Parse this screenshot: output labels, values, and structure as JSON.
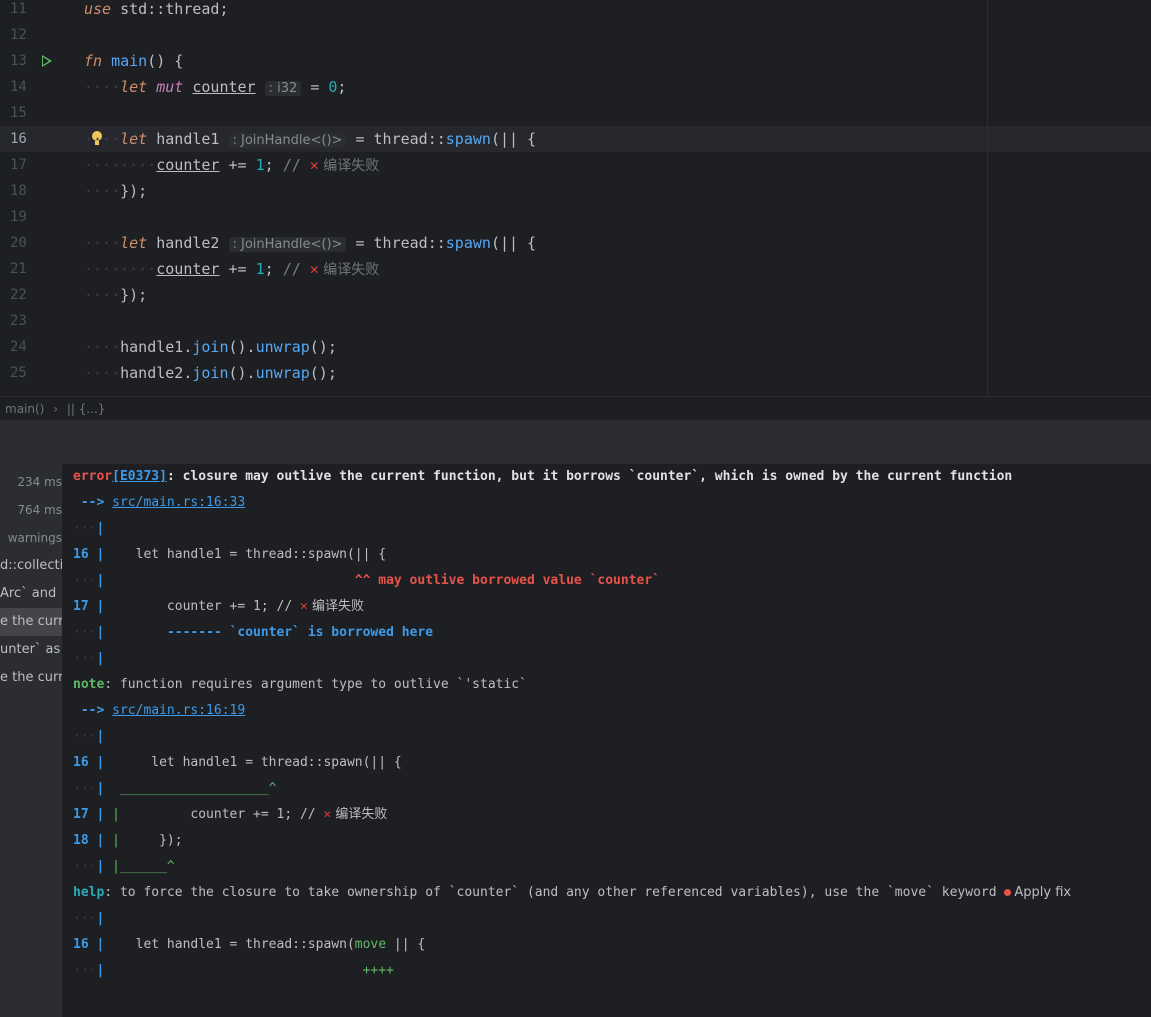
{
  "editor": {
    "line_numbers": [
      "11",
      "12",
      "13",
      "14",
      "15",
      "16",
      "17",
      "18",
      "19",
      "20",
      "21",
      "22",
      "23",
      "24",
      "25"
    ],
    "lines": {
      "l11": {
        "use": "use",
        "rest": " std::thread;"
      },
      "l13": {
        "fn": "fn",
        "name": "main",
        "rest": "() {"
      },
      "l14": {
        "let": "let",
        "mut": "mut",
        "var": "counter",
        "hint": ": i32",
        "rest": " = ",
        "num": "0",
        "end": ";"
      },
      "l16": {
        "let": "let",
        "var": "handle1",
        "hint": ": JoinHandle<()>",
        "rest": " = thread::",
        "fn": "spawn",
        "end": "(|| {"
      },
      "l17": {
        "var": "counter",
        "rest": " += ",
        "num": "1",
        "semi": "; ",
        "cmt": "// ",
        "cross": "✕",
        "cjk": " 编译失败"
      },
      "l18": {
        "text": "});"
      },
      "l20": {
        "let": "let",
        "var": "handle2",
        "hint": ": JoinHandle<()>",
        "rest": " = thread::",
        "fn": "spawn",
        "end": "(|| {"
      },
      "l21": {
        "var": "counter",
        "rest": " += ",
        "num": "1",
        "semi": "; ",
        "cmt": "// ",
        "cross": "✕",
        "cjk": " 编译失败"
      },
      "l22": {
        "text": "});"
      },
      "l24": {
        "a": "handle1.",
        "join": "join",
        "b": "().",
        "unwrap": "unwrap",
        "c": "();"
      },
      "l25": {
        "a": "handle2.",
        "join": "join",
        "b": "().",
        "unwrap": "unwrap",
        "c": "();"
      }
    }
  },
  "breadcrumb": {
    "item1": "main()",
    "sep": "›",
    "item2": "|| {...}"
  },
  "left_panel": {
    "items": [
      {
        "text": "234 ms"
      },
      {
        "text": "764 ms"
      },
      {
        "text": "warnings"
      },
      {
        "text": "d::collecti"
      },
      {
        "text": "Arc` and `"
      },
      {
        "text": "e the curre"
      },
      {
        "text": "unter` as"
      },
      {
        "text": "e the curre"
      }
    ]
  },
  "output": {
    "o1": {
      "err": "error",
      "code": "[E0373]",
      "msg": ": closure may outlive the current function, but it borrows `counter`, which is owned by the current function"
    },
    "o2": {
      "arrow": " --> ",
      "link": "src/main.rs:16:33"
    },
    "o3": {
      "bar": "|"
    },
    "o4": {
      "ln": "16",
      "bar": " |",
      "code": "    let handle1 = thread::spawn(|| {"
    },
    "o5": {
      "bar": "|",
      "pad": "                                ",
      "msg": "^^ may outlive borrowed value `counter`"
    },
    "o6": {
      "ln": "17",
      "bar": " |",
      "code": "        counter += 1; // ",
      "cross": "✕",
      "cjk": " 编译失败"
    },
    "o7": {
      "bar": "|",
      "pad": "        ",
      "msg": "------- `counter` is borrowed here"
    },
    "o8": {
      "bar": "|"
    },
    "o9": {
      "note": "note",
      "msg": ": function requires argument type to outlive `'static`"
    },
    "o10": {
      "arrow": " --> ",
      "link": "src/main.rs:16:19"
    },
    "o11": {
      "bar": "|"
    },
    "o12": {
      "ln": "16",
      "bar": " |",
      "code": "      let handle1 = thread::spawn(|| {"
    },
    "o13": {
      "bar": "|",
      "msg": "  ___________________^"
    },
    "o14": {
      "ln": "17",
      "bar": " |",
      "gbar": " |",
      "code": "         counter += 1; // ",
      "cross": "✕",
      "cjk": " 编译失败"
    },
    "o15": {
      "ln": "18",
      "bar": " |",
      "gbar": " |",
      "code": "     });"
    },
    "o16": {
      "bar": "|",
      "msg": " |______^"
    },
    "o17": {
      "help": "help",
      "msg": ": to force the closure to take ownership of `counter` (and any other referenced variables), use the `move` keyword",
      "fix": "Apply fix"
    },
    "o18": {
      "bar": "|"
    },
    "o19": {
      "ln": "16",
      "bar": " |",
      "code1": "    let handle1 = thread::spawn(",
      "move": "move",
      "code2": " || {"
    },
    "o20": {
      "bar": "|",
      "pad": "                                 ",
      "msg": "++++"
    }
  }
}
